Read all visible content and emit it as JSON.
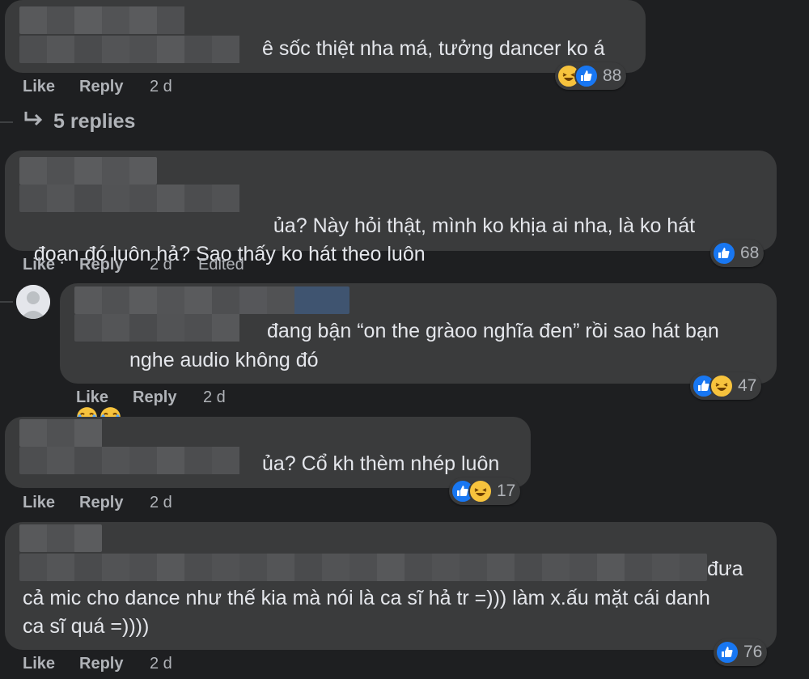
{
  "comments": [
    {
      "text": "ê sốc thiệt nha má, tưởng dancer ko á",
      "like": "Like",
      "reply": "Reply",
      "time": "2 d",
      "reactions": "88"
    },
    {
      "text": "ủa? Này hỏi thật, mình ko khịa ai nha, là ko hát\nđoạn đó luôn hả? Sao thấy ko hát theo luôn",
      "like": "Like",
      "reply": "Reply",
      "time": "2 d",
      "edited": "Edited",
      "reactions": "68"
    },
    {
      "text": "đang bận “on the gràoo nghĩa đen” rồi sao hát bạn",
      "text2": "nghe audio không đó",
      "like": "Like",
      "reply": "Reply",
      "time": "2 d",
      "reactions": "47"
    },
    {
      "text": "ủa? Cổ kh thèm nhép luôn",
      "like": "Like",
      "reply": "Reply",
      "time": "2 d",
      "reactions": "17"
    },
    {
      "text": "đưa",
      "text2": "cả mic cho dance như thế kia mà nói là ca sĩ hả tr =))) làm x.ấu mặt cái danh\nca sĩ quá =))))",
      "like": "Like",
      "reply": "Reply",
      "time": "2 d",
      "reactions": "76"
    }
  ],
  "replies_link": "5 replies",
  "icons": {
    "like": "like-reaction-icon",
    "haha": "haha-reaction-icon",
    "reply_arrow": "reply-arrow-icon",
    "avatar": "avatar-icon"
  },
  "colors": {
    "background": "#1e1f21",
    "bubble": "#3a3b3c",
    "text": "#e4e6eb",
    "muted": "#b0b3b8",
    "like_blue": "#1877f2",
    "haha_yellow": "#f7c33d"
  }
}
